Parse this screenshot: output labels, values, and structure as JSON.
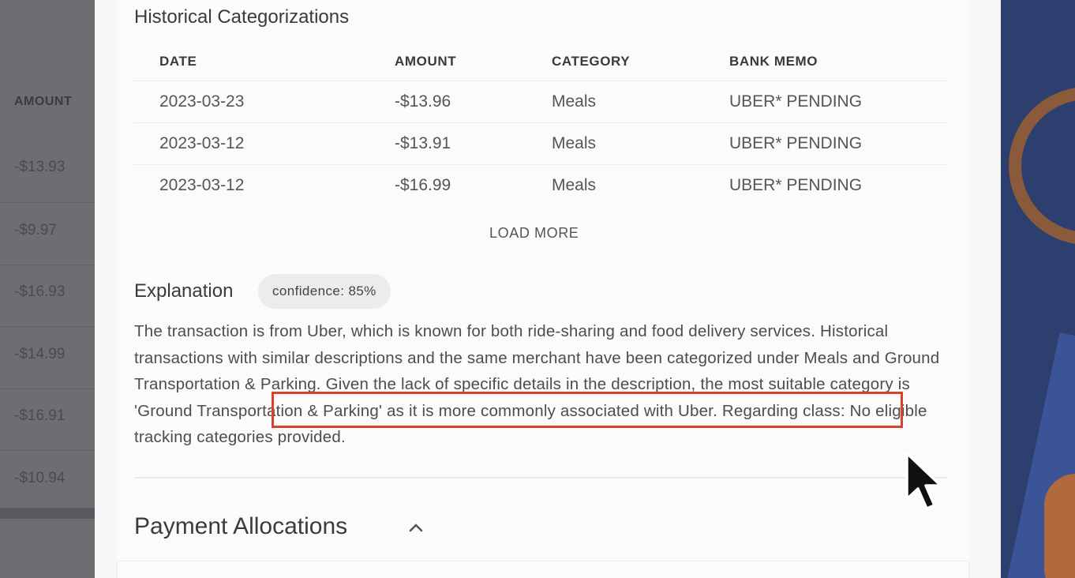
{
  "background": {
    "amount_header": "AMOUNT",
    "amounts": [
      "-$13.93",
      "-$9.97",
      "-$16.93",
      "-$14.99",
      "-$16.91",
      "-$10.94"
    ]
  },
  "historical": {
    "title": "Historical Categorizations",
    "columns": [
      "DATE",
      "AMOUNT",
      "CATEGORY",
      "BANK MEMO"
    ],
    "rows": [
      {
        "date": "2023-03-23",
        "amount": "-$13.96",
        "category": "Meals",
        "memo": "UBER* PENDING"
      },
      {
        "date": "2023-03-12",
        "amount": "-$13.91",
        "category": "Meals",
        "memo": "UBER* PENDING"
      },
      {
        "date": "2023-03-12",
        "amount": "-$16.99",
        "category": "Meals",
        "memo": "UBER* PENDING"
      }
    ],
    "load_more": "LOAD MORE"
  },
  "explanation": {
    "title": "Explanation",
    "confidence": "confidence: 85%",
    "text": "The transaction is from Uber, which is known for both ride-sharing and food delivery services. Historical transactions with similar descriptions and the same merchant have been categorized under Meals and Ground Transportation & Parking. Given the lack of specific details in the description, the most suitable category is 'Ground Transportation & Parking' as it is more commonly associated with Uber. Regarding class: No eligible tracking categories provided."
  },
  "payment": {
    "title": "Payment Allocations"
  },
  "colors": {
    "highlight": "#d9432c",
    "overlay": "#6f6f74",
    "card": "#fbfbfb"
  },
  "icons": {
    "chevron": "chevron-up-icon",
    "cursor": "mouse-pointer-icon"
  }
}
